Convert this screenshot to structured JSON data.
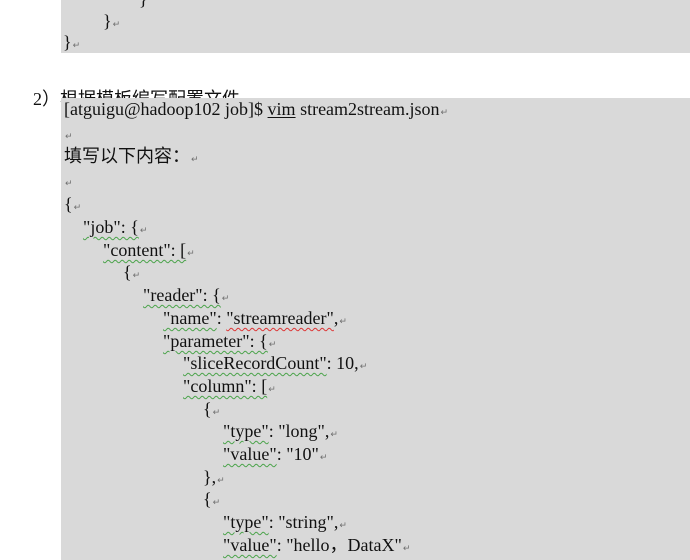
{
  "top_block": {
    "line1": "}",
    "line2": "}",
    "line3": "}"
  },
  "step_heading": "2）根据模板编写配置文件",
  "command": {
    "prompt": "[atguigu@hadoop102 job]$ ",
    "cmd": "vim",
    "arg": " stream2stream.json"
  },
  "fill_text": "填写以下内容：",
  "json_lines": {
    "open": "{",
    "job": "\"job\": {",
    "content": "\"content\": [",
    "obj_open": "{",
    "reader": "\"reader\": {",
    "name_key": "\"name\"",
    "name_sep": ": ",
    "name_val": "\"streamreader\"",
    "name_end": ",",
    "param": "\"parameter\": {",
    "slice_key": "\"sliceRecordCount\"",
    "slice_val": ": 10,",
    "column": "\"column\": [",
    "col1_open": "{",
    "type1_key": "\"type\"",
    "type1_val": ": \"long\",",
    "value1_key": "\"value\"",
    "value1_val": ": \"10\"",
    "col1_close": "},",
    "col2_open": "{",
    "type2_key": "\"type\"",
    "type2_val": ": \"string\",",
    "value2_key": "\"value\"",
    "value2_val": ": \"hello，DataX\""
  },
  "marks": {
    "para": "↵"
  }
}
